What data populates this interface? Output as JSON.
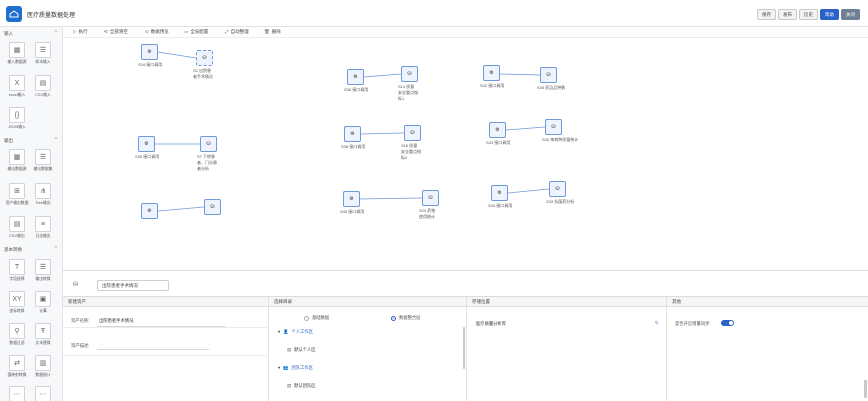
{
  "app": {
    "title": "医疗质量数据处理",
    "buttons": [
      {
        "label": "保存",
        "style": "default"
      },
      {
        "label": "发布",
        "style": "default"
      },
      {
        "label": "历史",
        "style": "default"
      },
      {
        "label": "帮助",
        "style": "primary"
      },
      {
        "label": "关闭",
        "style": "secondary"
      }
    ]
  },
  "sidebar": {
    "sections": [
      {
        "label": "输入",
        "items": [
          {
            "label": "输入数据源",
            "icon": "grid-icon"
          },
          {
            "label": "样本输入",
            "icon": "database-icon"
          },
          {
            "label": "excel输入",
            "icon": "excel-icon"
          },
          {
            "label": "CSV输入",
            "icon": "csv-icon"
          },
          {
            "label": "JSON输入",
            "icon": "json-icon"
          }
        ]
      },
      {
        "label": "输出",
        "items": [
          {
            "label": "输出数据源",
            "icon": "grid-icon"
          },
          {
            "label": "输出数据集",
            "icon": "database-icon"
          },
          {
            "label": "资产输出数据",
            "icon": "split-icon"
          },
          {
            "label": "Tree输出",
            "icon": "tree-icon"
          },
          {
            "label": "CSV输出",
            "icon": "csv-icon"
          },
          {
            "label": "日志输出",
            "icon": "log-icon"
          }
        ]
      },
      {
        "label": "基本转换",
        "items": [
          {
            "label": "字段选择",
            "icon": "text-field-icon"
          },
          {
            "label": "输出转换",
            "icon": "database-icon"
          },
          {
            "label": "坐标转换",
            "icon": "xy-icon"
          },
          {
            "label": "计算",
            "icon": "calc-icon"
          },
          {
            "label": "数据过滤",
            "icon": "filter-icon"
          },
          {
            "label": "文本替换",
            "icon": "text-replace-icon"
          },
          {
            "label": "值映射转换",
            "icon": "map-icon"
          },
          {
            "label": "数据统计",
            "icon": "chart-icon"
          }
        ]
      }
    ]
  },
  "toolbar": {
    "items": [
      {
        "label": "执行",
        "icon": "play-icon"
      },
      {
        "label": "全部清空",
        "icon": "clear-icon"
      },
      {
        "label": "数据预览",
        "icon": "preview-icon"
      },
      {
        "label": "全局配置",
        "icon": "config-icon"
      },
      {
        "label": "自动整理",
        "icon": "arrange-icon"
      },
      {
        "label": "删除",
        "icon": "delete-icon"
      }
    ]
  },
  "canvas": {
    "nodes": [
      {
        "id": "n1",
        "label": "S34 接口调用",
        "type": "api"
      },
      {
        "id": "n2",
        "label": "S2 出院患者手术情况",
        "type": "output"
      },
      {
        "id": "n3",
        "label": "S36 接口调用",
        "type": "api"
      },
      {
        "id": "n4",
        "label": "S14 质量安全重点指标1",
        "type": "output"
      },
      {
        "id": "n5",
        "label": "S42 接口调用",
        "type": "api"
      },
      {
        "id": "n6",
        "label": "S45 药品品种数",
        "type": "output"
      },
      {
        "id": "n7",
        "label": "S35 接口调用",
        "type": "api"
      },
      {
        "id": "n8",
        "label": "S7 下转患者、门诊患者分析",
        "type": "output"
      },
      {
        "id": "n9",
        "label": "S38 接口调用",
        "type": "api"
      },
      {
        "id": "n10",
        "label": "S16 质量安全重点指标2",
        "type": "output"
      },
      {
        "id": "n11",
        "label": "S43 接口调用",
        "type": "api"
      },
      {
        "id": "n12",
        "label": "S30 单病种质量统计",
        "type": "output"
      },
      {
        "id": "n13",
        "label": "",
        "type": "api"
      },
      {
        "id": "n14",
        "label": "",
        "type": "output"
      },
      {
        "id": "n15",
        "label": "S40 接口调用",
        "type": "api"
      },
      {
        "id": "n16",
        "label": "S23 药物使用统计",
        "type": "output"
      },
      {
        "id": "n17",
        "label": "S44 接口调用",
        "type": "api"
      },
      {
        "id": "n18",
        "label": "S33 抗菌药分析",
        "type": "output"
      }
    ]
  },
  "footer": {
    "selected_node": "出院患者手术情况"
  },
  "panels": {
    "asset": {
      "title": "新建资产",
      "name_label": "资产名称:",
      "name_value": "出院患者手术情况",
      "desc_label": "资产描述:"
    },
    "directory": {
      "title": "选择目录",
      "radio1": "基础数据",
      "radio2": "数据整合层",
      "tree": [
        {
          "label": "个人工作区",
          "kind": "group"
        },
        {
          "label": "默认个人区",
          "kind": "leaf"
        },
        {
          "label": "团队工作区",
          "kind": "group"
        },
        {
          "label": "默认团队区",
          "kind": "leaf"
        }
      ]
    },
    "location": {
      "title": "存储位置",
      "item": "医疗质量分析库"
    },
    "other": {
      "title": "其他",
      "toggle_label": "是否开启增量同步:",
      "toggle_on": true
    }
  },
  "colors": {
    "accent": "#2a62c9",
    "node_border": "#6f99d9",
    "node_fill": "#eef4fd"
  }
}
